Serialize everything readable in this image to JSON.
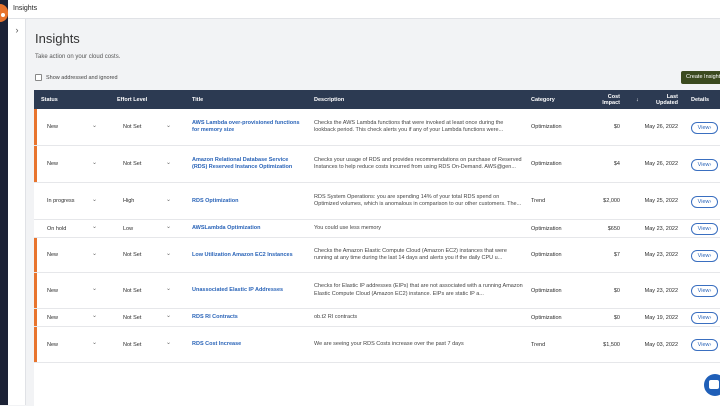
{
  "app": {
    "title": "Insights"
  },
  "header": {
    "title": "Insights",
    "subtitle": "Take action on your cloud costs.",
    "show_addressed_label": "Show addressed and ignored",
    "create_button": "Create Insight"
  },
  "table": {
    "columns": {
      "status": "Status",
      "effort": "Effort Level",
      "title": "Title",
      "description": "Description",
      "category": "Category",
      "cost_impact": "Cost Impact",
      "last_updated": "Last Updated",
      "details": "Details"
    },
    "sort_icon": "arrow-down-icon",
    "view_label": "View",
    "rows": [
      {
        "status": "New",
        "effort": "Not Set",
        "title": "AWS Lambda over-provisioned functions for memory size",
        "description": "Checks the AWS Lambda functions that were invoked at least once during the lookback period. This check alerts you if any of your Lambda functions were...",
        "category": "Optimization",
        "cost": "$0",
        "updated": "May 26, 2022",
        "flagged": true
      },
      {
        "status": "New",
        "effort": "Not Set",
        "title": "Amazon Relational Database Service (RDS) Reserved Instance Optimization",
        "description": "Checks your usage of RDS and provides recommendations on purchase of Reserved Instances to help reduce costs incurred from using RDS On-Demand. AWS@gen...",
        "category": "Optimization",
        "cost": "$4",
        "updated": "May 26, 2022",
        "flagged": true
      },
      {
        "status": "In progress",
        "effort": "High",
        "title": "RDS Optimization",
        "description": "RDS System Operations: you are spending 14% of your total RDS spend on Optimized volumes, which is anomalous in comparison to our other customers. The...",
        "category": "Trend",
        "cost": "$2,000",
        "updated": "May 25, 2022",
        "flagged": false
      },
      {
        "status": "On hold",
        "effort": "Low",
        "title": "AWSLambda Optimization",
        "description": "You could use less memory",
        "category": "Optimization",
        "cost": "$650",
        "updated": "May 23, 2022",
        "flagged": false
      },
      {
        "status": "New",
        "effort": "Not Set",
        "title": "Low Utilization Amazon EC2 Instances",
        "description": "Checks the Amazon Elastic Compute Cloud (Amazon EC2) instances that were running at any time during the last 14 days and alerts you if the daily CPU u...",
        "category": "Optimization",
        "cost": "$7",
        "updated": "May 23, 2022",
        "flagged": true
      },
      {
        "status": "New",
        "effort": "Not Set",
        "title": "Unassociated Elastic IP Addresses",
        "description": "Checks for Elastic IP addresses (EIPs) that are not associated with a running Amazon Elastic Compute Cloud (Amazon EC2) instance. EIPs are static IP a...",
        "category": "Optimization",
        "cost": "$0",
        "updated": "May 23, 2022",
        "flagged": true
      },
      {
        "status": "New",
        "effort": "Not Set",
        "title": "RDS RI Contracts",
        "description": "ob.t2 RI contracts",
        "category": "Optimization",
        "cost": "$0",
        "updated": "May 19, 2022",
        "flagged": true
      },
      {
        "status": "New",
        "effort": "Not Set",
        "title": "RDS Cost Increase",
        "description": "We are seeing your RDS Costs increase over the past 7 days",
        "category": "Trend",
        "cost": "$1,500",
        "updated": "May 03, 2022",
        "flagged": true
      }
    ]
  },
  "icons": {
    "expand": "chevron-right-icon",
    "dropdown": "chevron-down-icon",
    "view": "chevron-right-icon",
    "chat": "chat-icon"
  },
  "colors": {
    "accent_orange": "#e8742d",
    "header_navy": "#2c3a52",
    "link_blue": "#2a64b8",
    "create_green": "#3b4a1f"
  }
}
